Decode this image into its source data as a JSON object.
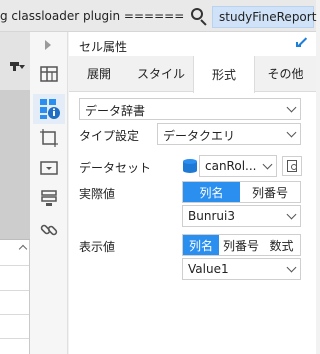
{
  "topbar": {
    "breadcrumb": "g classloader plugin ======",
    "report_name": "studyFineReport"
  },
  "panel": {
    "title": "セル属性",
    "tabs": [
      {
        "label": "展開"
      },
      {
        "label": "スタイル"
      },
      {
        "label": "形式"
      },
      {
        "label": "その他"
      }
    ],
    "active_tab": "形式",
    "data_type": "データ辞書",
    "type_setting": {
      "label": "タイプ設定",
      "value": "データクエリ"
    },
    "dataset": {
      "label": "データセット",
      "value": "canRol..."
    },
    "actual_value": {
      "label": "実際値",
      "options": [
        "列名",
        "列番号"
      ],
      "selected": "列名",
      "column": "Bunrui3"
    },
    "display_value": {
      "label": "表示値",
      "options": [
        "列名",
        "列番号",
        "数式"
      ],
      "selected": "列名",
      "column": "Value1"
    }
  },
  "rail": {
    "icons": [
      "expand-arrow-icon",
      "cell-grid-icon",
      "cell-attribute-icon",
      "border-icon",
      "widget-icon",
      "condition-icon",
      "hyperlink-icon"
    ],
    "selected": "cell-attribute-icon"
  },
  "colors": {
    "accent": "#2b8ff0",
    "report_tab_bg": "#cfe2f7",
    "rail_selected_bg": "#e3ecf7"
  }
}
